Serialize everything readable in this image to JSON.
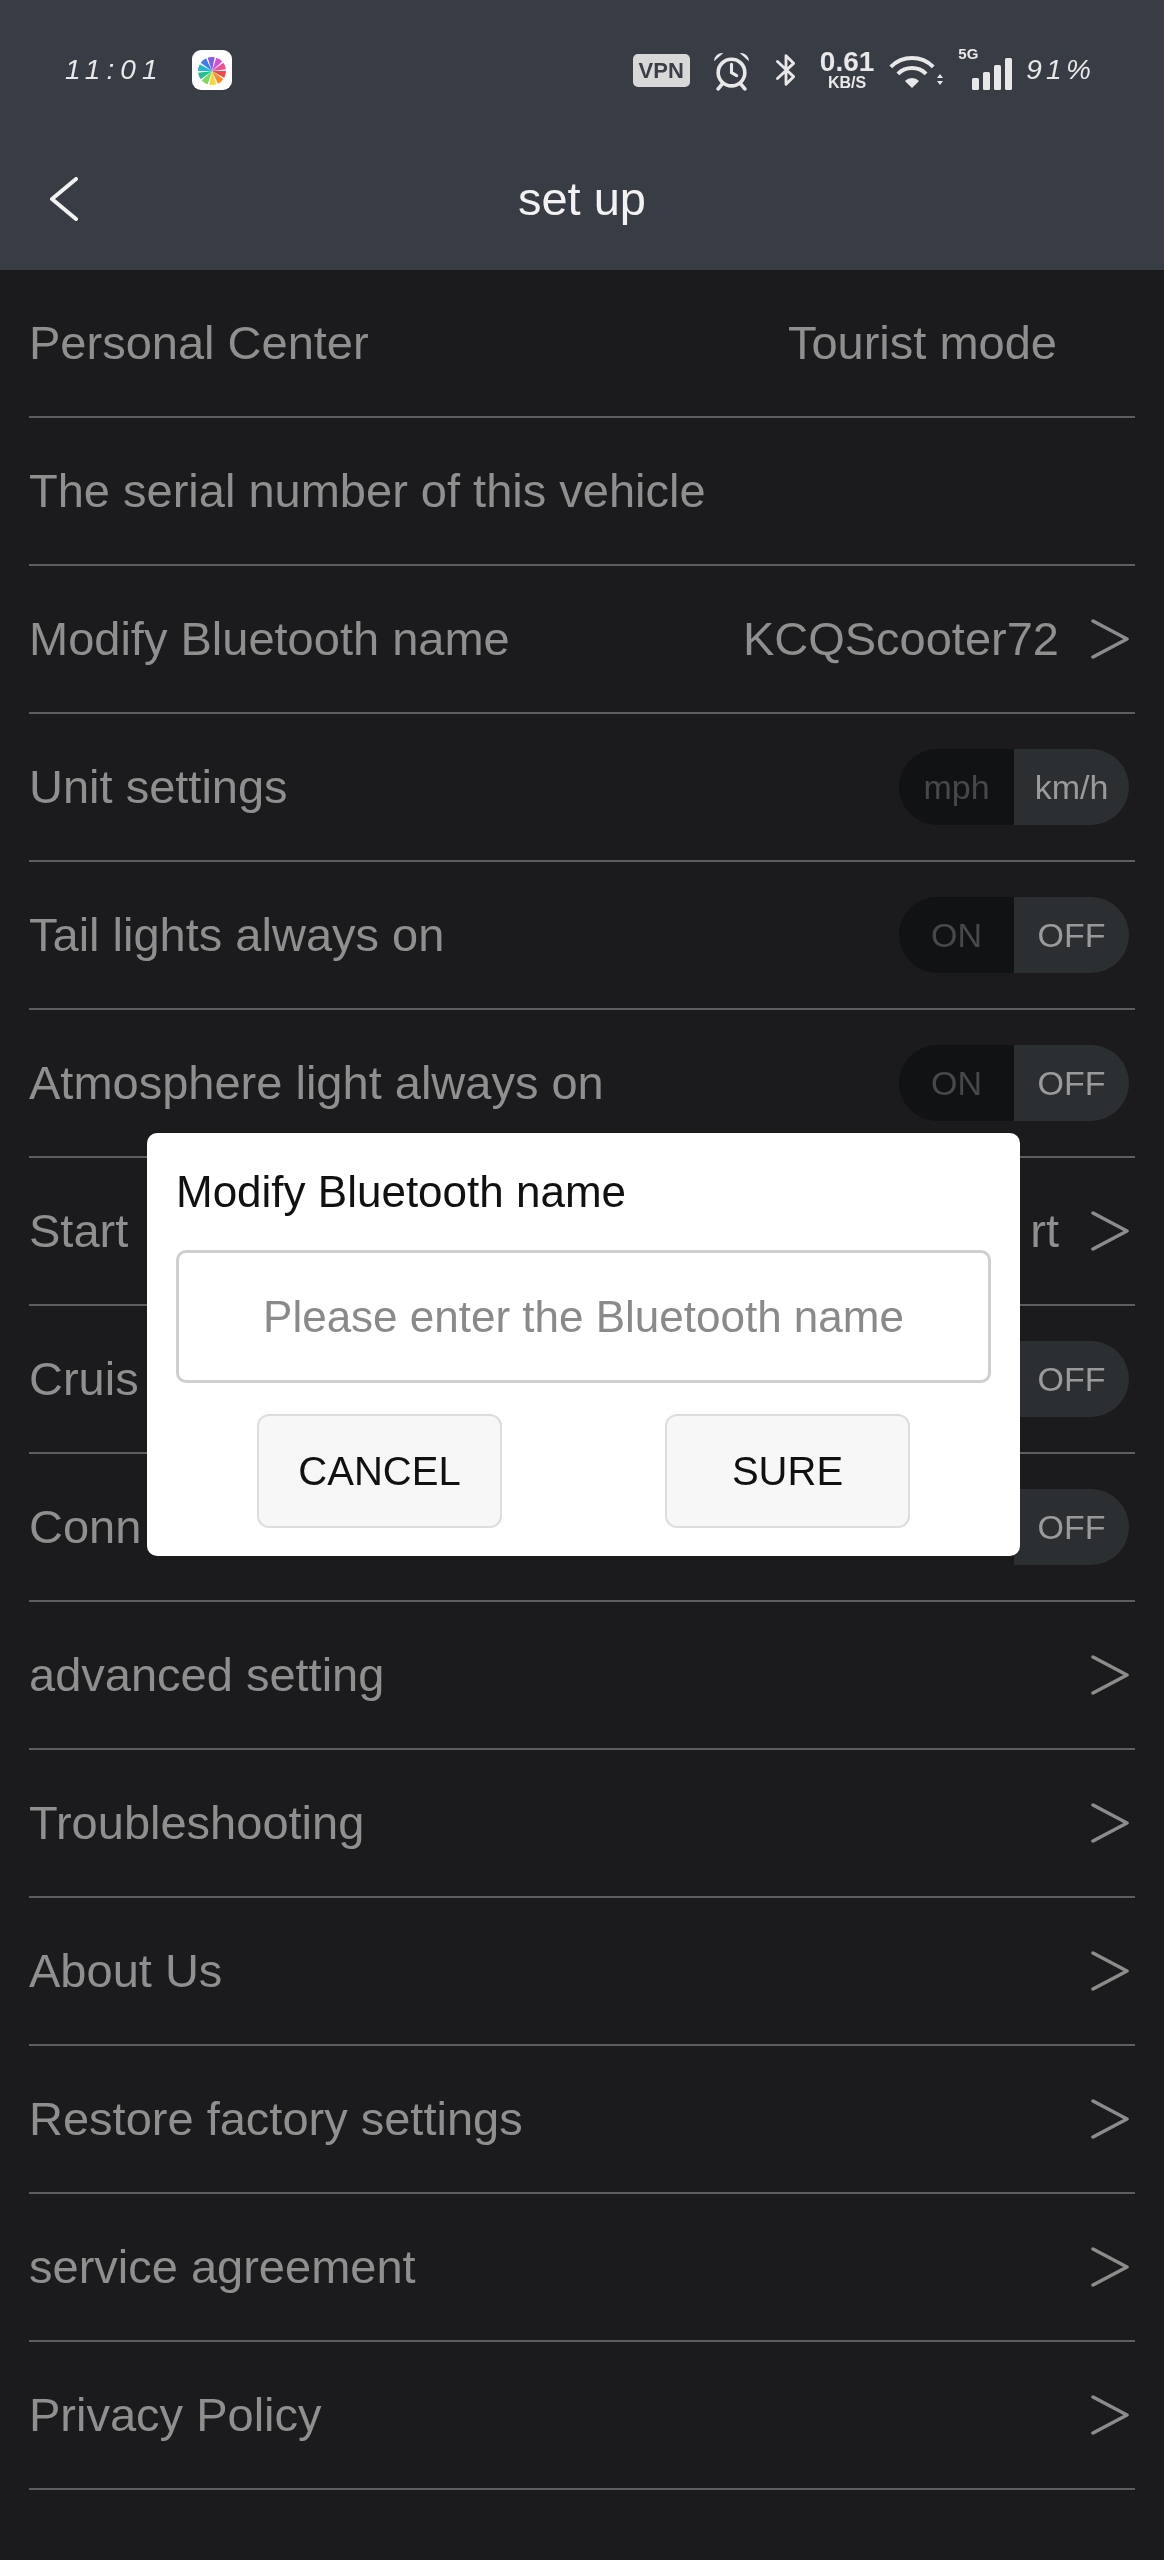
{
  "status_bar": {
    "time": "11:01",
    "vpn": "VPN",
    "net_speed": "0.61",
    "net_speed_unit": "KB/S",
    "network": "5G",
    "battery": "91%"
  },
  "header": {
    "title": "set up"
  },
  "settings": [
    {
      "kind": "value",
      "label": "Personal Center",
      "value": "Tourist mode"
    },
    {
      "kind": "plain",
      "label": "The serial number of this vehicle"
    },
    {
      "kind": "link",
      "label": "Modify Bluetooth name",
      "value": "KCQScooter72"
    },
    {
      "kind": "segmented",
      "label": "Unit settings",
      "options": [
        {
          "label": "mph",
          "selected": false
        },
        {
          "label": "km/h",
          "selected": true
        }
      ]
    },
    {
      "kind": "segmented",
      "label": "Tail lights always on",
      "options": [
        {
          "label": "ON",
          "selected": false
        },
        {
          "label": "OFF",
          "selected": true
        }
      ]
    },
    {
      "kind": "segmented",
      "label": "Atmosphere light always on",
      "options": [
        {
          "label": "ON",
          "selected": false
        },
        {
          "label": "OFF",
          "selected": true
        }
      ]
    },
    {
      "kind": "link",
      "label": "Start",
      "value": "rt"
    },
    {
      "kind": "segmented",
      "label": "Cruis",
      "options": [
        {
          "label": "OFF",
          "selected": true
        }
      ]
    },
    {
      "kind": "segmented",
      "label": "Conn",
      "options": [
        {
          "label": "OFF",
          "selected": true
        }
      ]
    },
    {
      "kind": "link",
      "label": "advanced setting"
    },
    {
      "kind": "link",
      "label": "Troubleshooting"
    },
    {
      "kind": "link",
      "label": "About Us"
    },
    {
      "kind": "link",
      "label": "Restore factory settings"
    },
    {
      "kind": "link",
      "label": "service agreement"
    },
    {
      "kind": "link",
      "label": "Privacy Policy"
    }
  ],
  "dialog": {
    "title": "Modify Bluetooth name",
    "input": {
      "placeholder": "Please enter the Bluetooth name"
    },
    "buttons": [
      "CANCEL",
      "SURE"
    ]
  }
}
